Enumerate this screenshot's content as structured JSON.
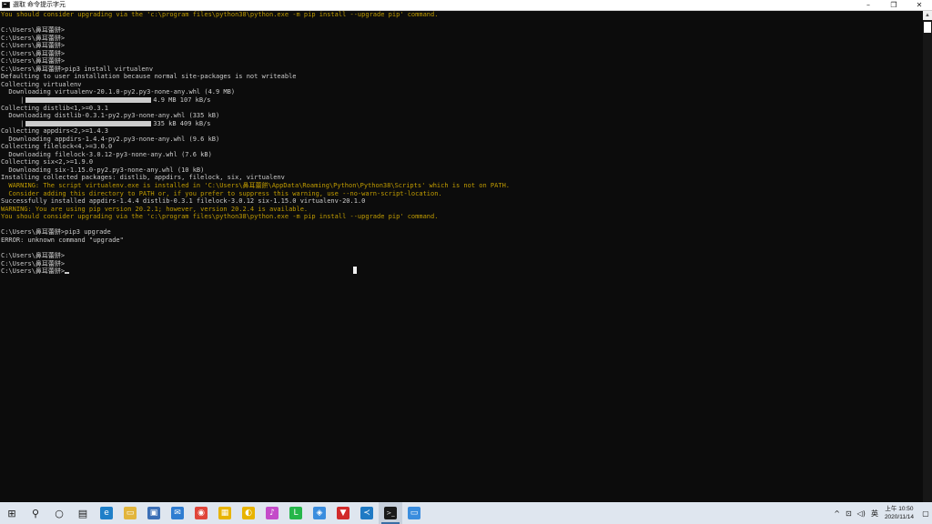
{
  "window": {
    "title": "選取 命令提示字元",
    "minimize_glyph": "–",
    "maximize_glyph": "❐",
    "close_glyph": "✕"
  },
  "console": {
    "lines": [
      {
        "text": "You should consider upgrading via the 'c:\\program files\\python38\\python.exe -m pip install --upgrade pip' command.",
        "style": "warn"
      },
      {
        "text": "",
        "style": "normal"
      },
      {
        "text": "C:\\Users\\鼻耳蕾餅>",
        "style": "normal"
      },
      {
        "text": "C:\\Users\\鼻耳蕾餅>",
        "style": "normal"
      },
      {
        "text": "C:\\Users\\鼻耳蕾餅>",
        "style": "normal"
      },
      {
        "text": "C:\\Users\\鼻耳蕾餅>",
        "style": "normal"
      },
      {
        "text": "C:\\Users\\鼻耳蕾餅>",
        "style": "normal"
      },
      {
        "text": "C:\\Users\\鼻耳蕾餅>pip3 install virtualenv",
        "style": "normal"
      },
      {
        "text": "Defaulting to user installation because normal site-packages is not writeable",
        "style": "normal"
      },
      {
        "text": "Collecting virtualenv",
        "style": "normal"
      },
      {
        "text": "  Downloading virtualenv-20.1.0-py2.py3-none-any.whl (4.9 MB)",
        "style": "normal"
      },
      {
        "text": "     |",
        "style": "progress",
        "suffix": "4.9 MB 107 kB/s"
      },
      {
        "text": "Collecting distlib<1,>=0.3.1",
        "style": "normal"
      },
      {
        "text": "  Downloading distlib-0.3.1-py2.py3-none-any.whl (335 kB)",
        "style": "normal"
      },
      {
        "text": "     |",
        "style": "progress",
        "suffix": "335 kB 409 kB/s"
      },
      {
        "text": "Collecting appdirs<2,>=1.4.3",
        "style": "normal"
      },
      {
        "text": "  Downloading appdirs-1.4.4-py2.py3-none-any.whl (9.6 kB)",
        "style": "normal"
      },
      {
        "text": "Collecting filelock<4,>=3.0.0",
        "style": "normal"
      },
      {
        "text": "  Downloading filelock-3.0.12-py3-none-any.whl (7.6 kB)",
        "style": "normal"
      },
      {
        "text": "Collecting six<2,>=1.9.0",
        "style": "normal"
      },
      {
        "text": "  Downloading six-1.15.0-py2.py3-none-any.whl (10 kB)",
        "style": "normal"
      },
      {
        "text": "Installing collected packages: distlib, appdirs, filelock, six, virtualenv",
        "style": "normal"
      },
      {
        "text": "  WARNING: The script virtualenv.exe is installed in 'C:\\Users\\鼻耳蕾餅\\AppData\\Roaming\\Python\\Python38\\Scripts' which is not on PATH.",
        "style": "warn"
      },
      {
        "text": "  Consider adding this directory to PATH or, if you prefer to suppress this warning, use --no-warn-script-location.",
        "style": "warn"
      },
      {
        "text": "Successfully installed appdirs-1.4.4 distlib-0.3.1 filelock-3.0.12 six-1.15.0 virtualenv-20.1.0",
        "style": "normal"
      },
      {
        "text": "WARNING: You are using pip version 20.2.1; however, version 20.2.4 is available.",
        "style": "warn"
      },
      {
        "text": "You should consider upgrading via the 'c:\\program files\\python38\\python.exe -m pip install --upgrade pip' command.",
        "style": "warn"
      },
      {
        "text": "",
        "style": "normal"
      },
      {
        "text": "C:\\Users\\鼻耳蕾餅>pip3 upgrade",
        "style": "normal"
      },
      {
        "text": "ERROR: unknown command \"upgrade\"",
        "style": "normal"
      },
      {
        "text": "",
        "style": "normal"
      },
      {
        "text": "C:\\Users\\鼻耳蕾餅>",
        "style": "normal"
      },
      {
        "text": "C:\\Users\\鼻耳蕾餅>",
        "style": "normal"
      },
      {
        "text": "C:\\Users\\鼻耳蕾餅>",
        "style": "cursor"
      }
    ],
    "colors": {
      "text": "#cccccc",
      "warn": "#c19c00",
      "background": "#0c0c0c"
    }
  },
  "taskbar": {
    "apps": [
      {
        "name": "start-icon",
        "glyph": "⊞",
        "color": "#1a1a1a",
        "active": false
      },
      {
        "name": "search-icon",
        "glyph": "⚲",
        "color": "#1a1a1a",
        "active": false
      },
      {
        "name": "cortana-icon",
        "glyph": "○",
        "color": "#1a1a1a",
        "active": false
      },
      {
        "name": "task-view-icon",
        "glyph": "▤",
        "color": "#1a1a1a",
        "active": false
      },
      {
        "name": "edge-icon",
        "glyph": "e",
        "color": "#1f7fc8",
        "active": false
      },
      {
        "name": "file-explorer-icon",
        "glyph": "▭",
        "color": "#e2b53c",
        "active": false
      },
      {
        "name": "store-icon",
        "glyph": "▣",
        "color": "#3b6fb6",
        "active": false
      },
      {
        "name": "mail-icon",
        "glyph": "✉",
        "color": "#2f7dd1",
        "active": false
      },
      {
        "name": "chrome-icon",
        "glyph": "◉",
        "color": "#e0453a",
        "active": false
      },
      {
        "name": "sticky-app-icon",
        "glyph": "▦",
        "color": "#e8b400",
        "active": false
      },
      {
        "name": "media-icon",
        "glyph": "◐",
        "color": "#e8b400",
        "active": false
      },
      {
        "name": "music-icon",
        "glyph": "♪",
        "color": "#c44bc9",
        "active": false
      },
      {
        "name": "line-icon",
        "glyph": "L",
        "color": "#25b64a",
        "active": false
      },
      {
        "name": "browser-icon",
        "glyph": "◈",
        "color": "#3a8dde",
        "active": false
      },
      {
        "name": "pdf-icon",
        "glyph": "▼",
        "color": "#d12a2a",
        "active": false
      },
      {
        "name": "vscode-icon",
        "glyph": "≺",
        "color": "#1f7ac4",
        "active": false
      },
      {
        "name": "cmd-icon",
        "glyph": ">_",
        "color": "#1a1a1a",
        "active": true
      },
      {
        "name": "remote-desktop-icon",
        "glyph": "▭",
        "color": "#3a8dde",
        "active": false
      }
    ],
    "tray": {
      "chevron": "^",
      "network_glyph": "⊡",
      "volume_glyph": "◁)",
      "ime": "英",
      "time": "上午 10:50",
      "date": "2020/11/14",
      "notification_glyph": "▢"
    }
  }
}
